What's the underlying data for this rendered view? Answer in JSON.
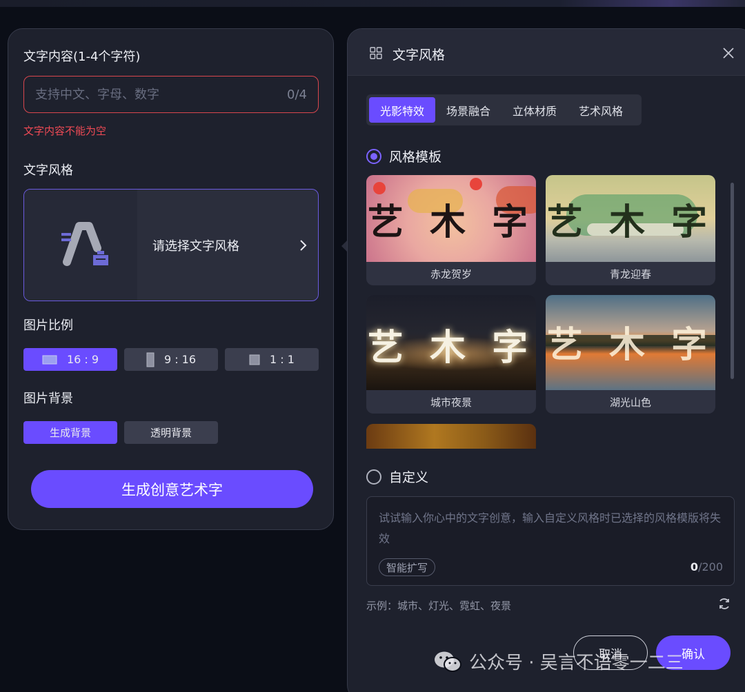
{
  "left": {
    "text_label": "文字内容(1-4个字符)",
    "input_placeholder": "支持中文、字母、数字",
    "input_counter": "0/4",
    "error": "文字内容不能为空",
    "style_label": "文字风格",
    "style_picker_text": "请选择文字风格",
    "ratio_label": "图片比例",
    "ratios": [
      "16 : 9",
      "9 : 16",
      "1 : 1"
    ],
    "selected_ratio": "16 : 9",
    "bg_label": "图片背景",
    "bg_options": [
      "生成背景",
      "透明背景"
    ],
    "selected_bg": "生成背景",
    "generate_button": "生成创意艺术字"
  },
  "right": {
    "title": "文字风格",
    "tabs": [
      "光影特效",
      "场景融合",
      "立体材质",
      "艺术风格"
    ],
    "active_tab": "光影特效",
    "template_radio": "风格模板",
    "templates": [
      {
        "name": "赤龙贺岁",
        "art": "艺 木 字"
      },
      {
        "name": "青龙迎春",
        "art": "艺 木 字"
      },
      {
        "name": "城市夜景",
        "art": "艺 木 字"
      },
      {
        "name": "湖光山色",
        "art": "艺 木 字"
      }
    ],
    "custom_radio": "自定义",
    "custom_placeholder": "试试输入你心中的文字创意，输入自定义风格时已选择的风格模版将失效",
    "expand_tag": "智能扩写",
    "custom_counter_value": "0",
    "custom_counter_max": "/200",
    "example": "示例：城市、灯光、霓虹、夜景",
    "cancel_button": "取消",
    "confirm_button": "确认"
  },
  "watermark": "公众号 · 吴言不语零一二三",
  "colors": {
    "accent": "#6a4cff",
    "error": "#ef4a55",
    "panel": "#1e212d",
    "background": "#0b0e17"
  }
}
